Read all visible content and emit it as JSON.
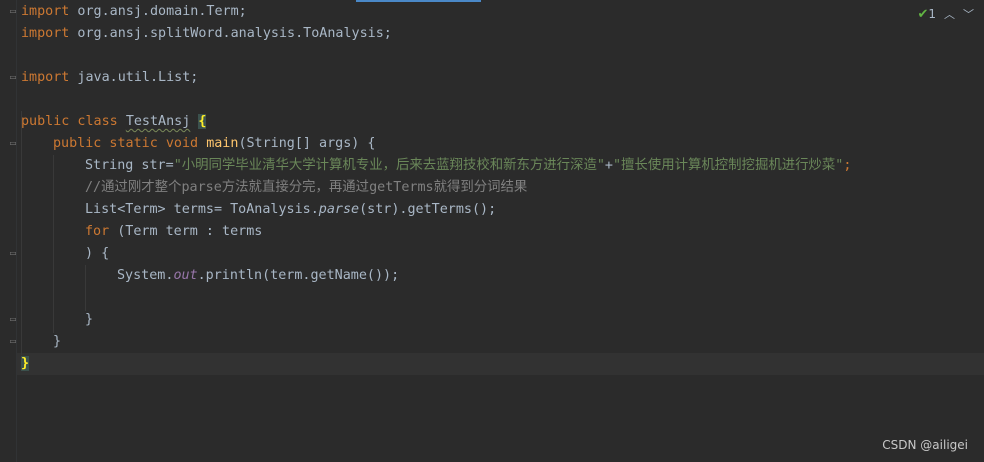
{
  "code": {
    "l1": {
      "kw": "import",
      "rest": " org.ansj.domain.Term;"
    },
    "l2": {
      "kw": "import",
      "rest": " org.ansj.splitWord.analysis.ToAnalysis;"
    },
    "l4": {
      "kw": "import",
      "rest": " java.util.List;"
    },
    "l6": {
      "kw": "public class",
      "name": "TestAnsj",
      "brace": "{"
    },
    "l7": {
      "kw": "public static void",
      "fn": "main",
      "rest": "(String[] args) {"
    },
    "l8": {
      "pre": "String str=",
      "s1": "\"小明同学毕业清华大学计算机专业，后来去蓝翔技校和新东方进行深造\"",
      "plus": "+",
      "s2": "\"擅长使用计算机控制挖掘机进行炒菜\"",
      "semi": ";"
    },
    "l9": {
      "comment": "//通过刚才整个parse方法就直接分完，再通过getTerms就得到分词结果"
    },
    "l10": {
      "pre": "List<Term> terms= ToAnalysis.",
      "method": "parse",
      "post": "(str).getTerms();"
    },
    "l11": {
      "kw": "for",
      "rest": " (Term term : terms"
    },
    "l12": {
      "text": ") {"
    },
    "l13": {
      "pre": "System.",
      "field": "out",
      "post": ".println(term.getName());"
    },
    "l15": {
      "text": "}"
    },
    "l16": {
      "text": "}"
    },
    "l17": {
      "text": "}"
    }
  },
  "indicator": {
    "count": "1"
  },
  "watermark": "CSDN @ailigei"
}
